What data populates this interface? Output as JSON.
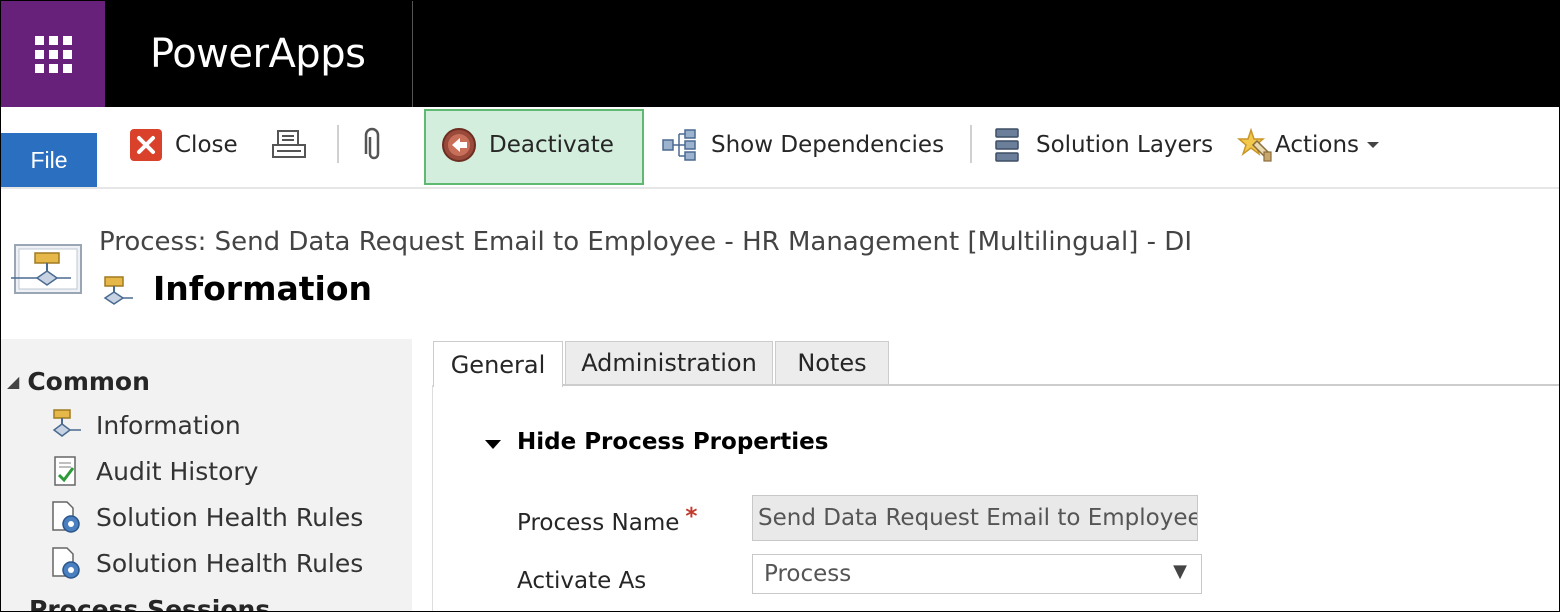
{
  "app": {
    "title": "PowerApps"
  },
  "toolbar": {
    "file_label": "File",
    "close_label": "Close",
    "deactivate_label": "Deactivate",
    "show_dependencies_label": "Show Dependencies",
    "solution_layers_label": "Solution Layers",
    "actions_label": "Actions"
  },
  "header": {
    "process_title": "Process: Send Data Request Email to Employee - HR Management [Multilingual] - DI",
    "form_title": "Information"
  },
  "nav": {
    "group": "Common",
    "items": [
      {
        "label": "Information",
        "icon": "process-icon"
      },
      {
        "label": "Audit History",
        "icon": "audit-history-icon"
      },
      {
        "label": "Solution Health Rules",
        "icon": "health-rules-icon"
      },
      {
        "label": "Solution Health Rules",
        "icon": "health-rules-icon"
      }
    ],
    "next_group_partial": "Process Sessions"
  },
  "tabs": [
    {
      "label": "General",
      "active": true
    },
    {
      "label": "Administration",
      "active": false
    },
    {
      "label": "Notes",
      "active": false
    }
  ],
  "section": {
    "label": "Hide Process Properties"
  },
  "fields": {
    "process_name": {
      "label": "Process Name",
      "required_marker": "*",
      "value": "Send Data Request Email to Employee - HR Management [Multilingual] - DI"
    },
    "activate_as": {
      "label": "Activate As",
      "value": "Process"
    }
  },
  "colors": {
    "waffle_bg": "#68217a",
    "file_button": "#2b70c0",
    "deactivate_highlight": "#d3eedd",
    "deactivate_border": "#5fb970"
  }
}
